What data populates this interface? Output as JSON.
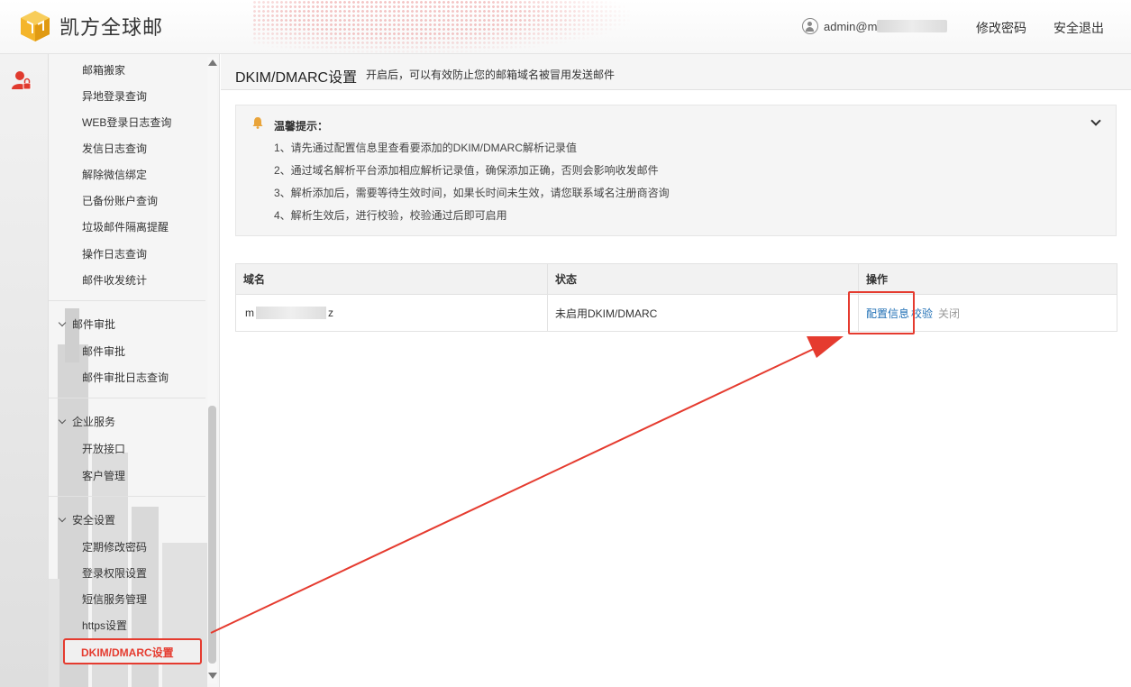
{
  "header": {
    "logo_text": "凯方全球邮",
    "user_prefix": "admin@m",
    "change_password": "修改密码",
    "logout": "安全退出"
  },
  "sidebar": {
    "items_top": [
      "邮箱搬家",
      "异地登录查询",
      "WEB登录日志查询",
      "发信日志查询",
      "解除微信绑定",
      "已备份账户查询",
      "垃圾邮件隔离提醒",
      "操作日志查询",
      "邮件收发统计"
    ],
    "groups": [
      {
        "title": "邮件审批",
        "items": [
          "邮件审批",
          "邮件审批日志查询"
        ]
      },
      {
        "title": "企业服务",
        "items": [
          "开放接口",
          "客户管理"
        ]
      },
      {
        "title": "安全设置",
        "items": [
          "定期修改密码",
          "登录权限设置",
          "短信服务管理",
          "https设置"
        ]
      }
    ],
    "active_item": "DKIM/DMARC设置"
  },
  "page": {
    "title": "DKIM/DMARC设置",
    "subtitle": "开启后，可以有效防止您的邮箱域名被冒用发送邮件"
  },
  "tips": {
    "title": "温馨提示：",
    "lines": [
      "1、请先通过配置信息里查看要添加的DKIM/DMARC解析记录值",
      "2、通过域名解析平台添加相应解析记录值，确保添加正确，否则会影响收发邮件",
      "3、解析添加后，需要等待生效时间，如果长时间未生效，请您联系域名注册商咨询",
      "4、解析生效后，进行校验，校验通过后即可启用"
    ]
  },
  "table": {
    "headers": [
      "域名",
      "状态",
      "操作"
    ],
    "rows": [
      {
        "domain_start": "m",
        "domain_end": "z",
        "status": "未启用DKIM/DMARC",
        "op_config": "配置信息",
        "op_verify": "校验",
        "op_close": "关闭"
      }
    ]
  },
  "colors": {
    "accent_red": "#e53b2f",
    "link_blue": "#1f6fb5"
  }
}
